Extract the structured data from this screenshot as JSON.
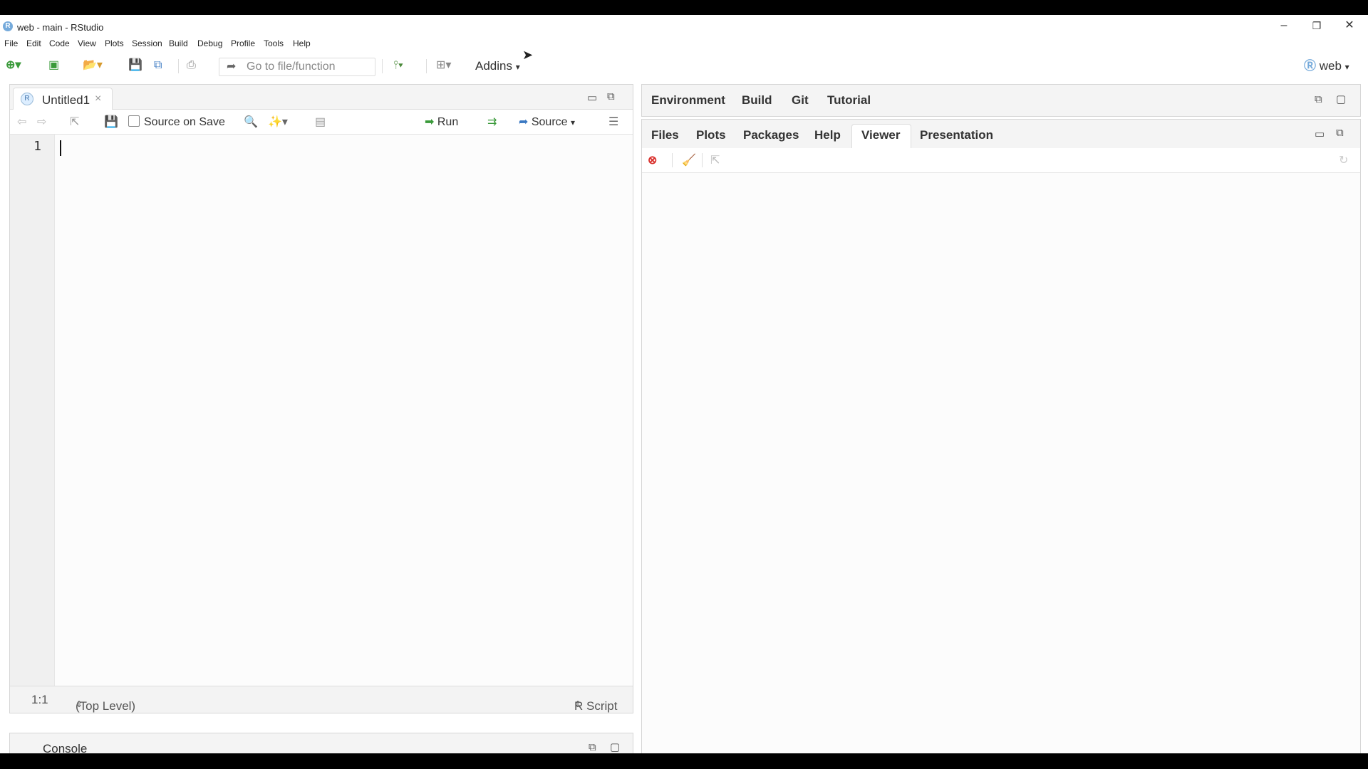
{
  "window": {
    "title": "web - main - RStudio",
    "r_logo": "R",
    "minimize_icon": "–",
    "maximize_icon": "❐",
    "close_icon": "✕"
  },
  "menu": [
    "File",
    "Edit",
    "Code",
    "View",
    "Plots",
    "Session",
    "Build",
    "Debug",
    "Profile",
    "Tools",
    "Help"
  ],
  "toolbar": {
    "goto_placeholder": "Go to file/function",
    "addins_label": "Addins",
    "project_label": "web"
  },
  "source_pane": {
    "tab_title": "Untitled1",
    "source_on_save_label": "Source on Save",
    "run_label": "Run",
    "source_label": "Source",
    "line_number": "1",
    "cursor_position": "1:1",
    "scope": "(Top Level)",
    "file_type": "R Script"
  },
  "console": {
    "label": "Console"
  },
  "env_pane": {
    "tabs": [
      "Environment",
      "Build",
      "Git",
      "Tutorial"
    ]
  },
  "files_pane": {
    "tabs": [
      "Files",
      "Plots",
      "Packages",
      "Help",
      "Viewer",
      "Presentation"
    ],
    "active_tab": "Viewer"
  },
  "colors": {
    "accent_blue": "#3a78c2",
    "stop_red": "#d9302c",
    "green": "#3a9a3a"
  }
}
